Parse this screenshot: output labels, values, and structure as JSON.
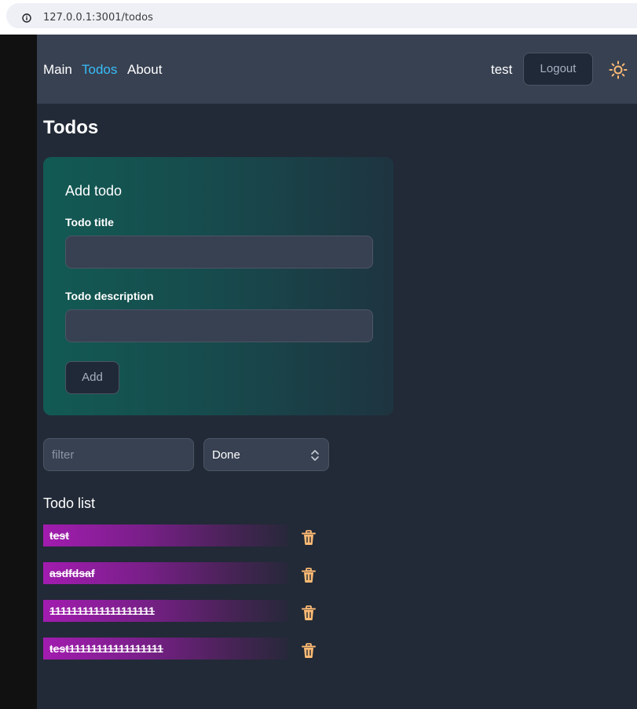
{
  "browser": {
    "url": "127.0.0.1:3001/todos",
    "info_icon": "info-icon"
  },
  "nav": {
    "links": [
      {
        "label": "Main",
        "active": false
      },
      {
        "label": "Todos",
        "active": true
      },
      {
        "label": "About",
        "active": false
      }
    ],
    "username": "test",
    "logout_label": "Logout",
    "theme_icon": "sun-icon"
  },
  "page": {
    "title": "Todos"
  },
  "add_form": {
    "heading": "Add todo",
    "title_label": "Todo title",
    "title_value": "",
    "description_label": "Todo description",
    "description_value": "",
    "add_label": "Add"
  },
  "filters": {
    "filter_placeholder": "filter",
    "filter_value": "",
    "status_selected": "Done"
  },
  "todo_list": {
    "heading": "Todo list",
    "items": [
      {
        "title": "test",
        "done": true
      },
      {
        "title": "asdfdsaf",
        "done": true
      },
      {
        "title": "1111111111111111111",
        "done": true
      },
      {
        "title": "test11111111111111111",
        "done": true
      }
    ],
    "delete_icon": "trash-icon"
  },
  "colors": {
    "accent": "#38bdf8",
    "app_bg": "#222a37",
    "nav_bg": "#384152",
    "card_gradient_start": "#125a54",
    "todo_gradient_start": "#a21caf",
    "trash": "#fdba74",
    "sun": "#fdba74"
  }
}
